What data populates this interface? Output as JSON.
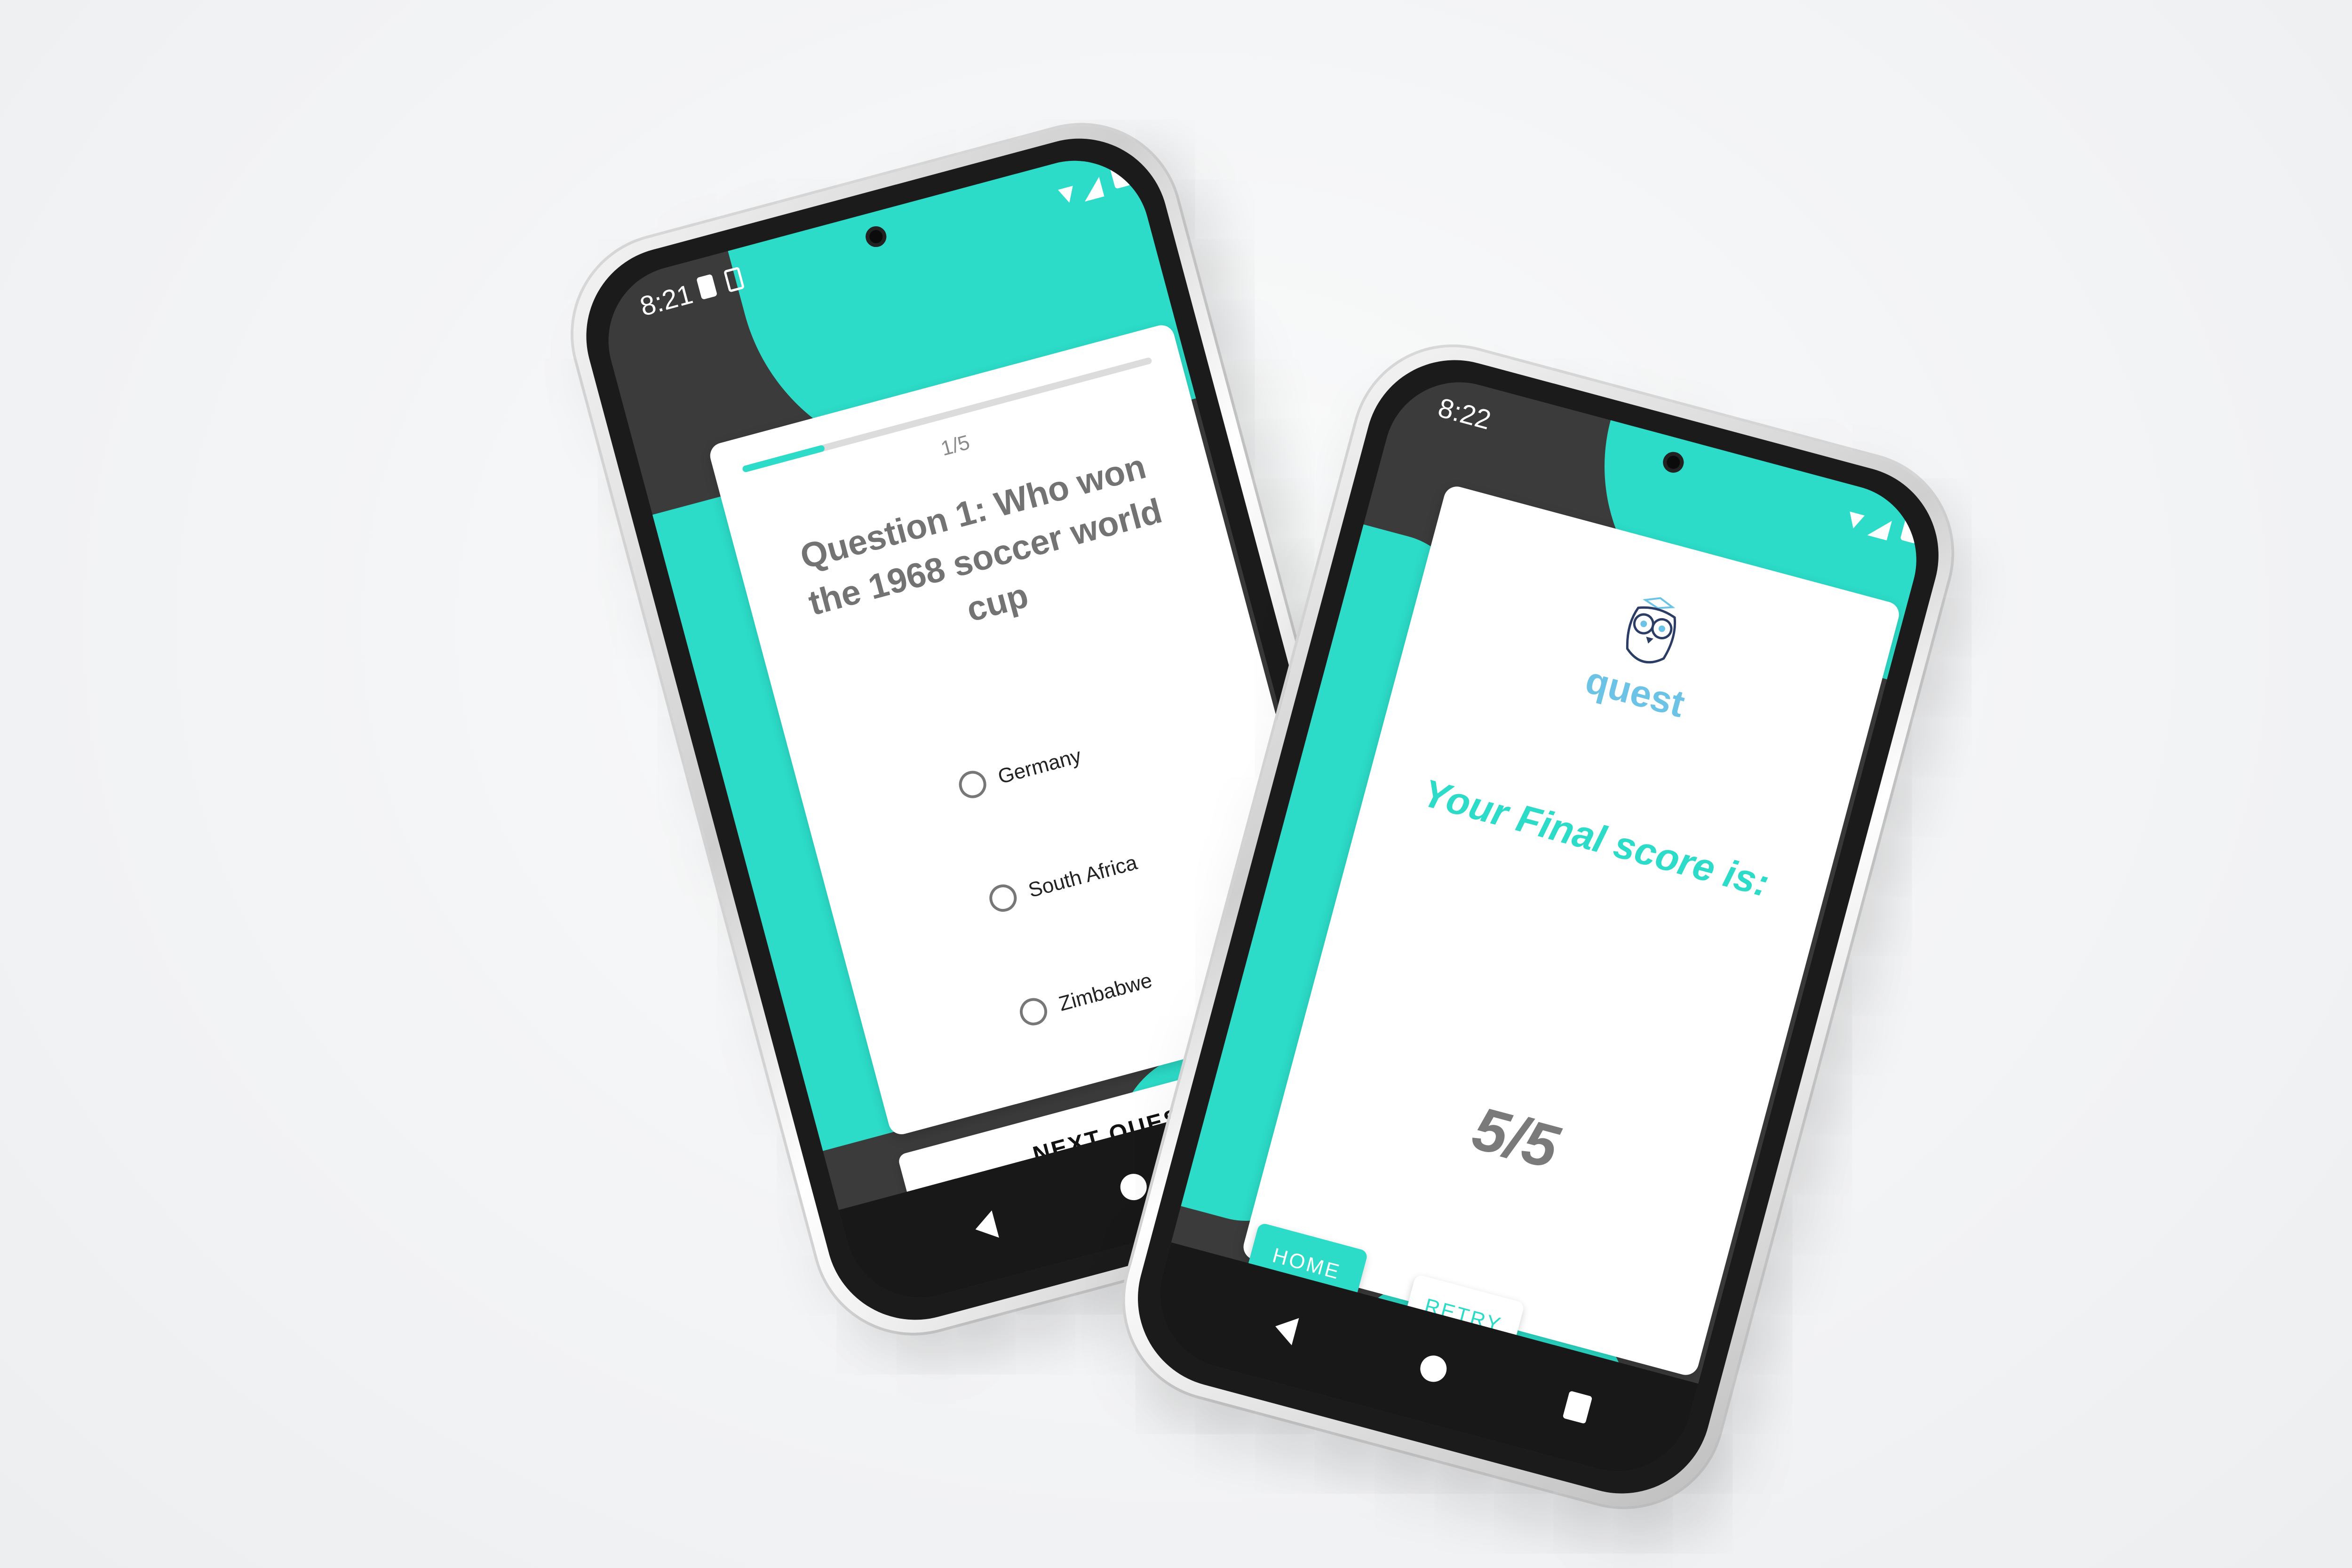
{
  "theme": {
    "accent": "#2cdcc8",
    "dark_background": "#3b3b3b",
    "logo_color": "#6cc3e6",
    "question_color": "#737373"
  },
  "quiz_screen": {
    "status": {
      "time": "8:21",
      "left_icons": [
        "sim-card-icon",
        "notification-icon"
      ],
      "right_icons": [
        "wifi-icon",
        "signal-icon",
        "battery-icon"
      ]
    },
    "progress": {
      "label": "1/5",
      "fraction": 0.2
    },
    "question": "Question 1: Who won the 1968 soccer world cup",
    "options": [
      "Germany",
      "South Africa",
      "Zimbabwe"
    ],
    "next_button": "NEXT QUESTION",
    "nav_icons": [
      "back-icon",
      "home-icon",
      "recent-apps-icon"
    ]
  },
  "result_screen": {
    "status": {
      "time": "8:22",
      "right_icons": [
        "wifi-icon",
        "signal-icon",
        "battery-icon"
      ]
    },
    "logo": {
      "icon": "owl-icon",
      "text": "quest"
    },
    "final_label": "Your Final score is:",
    "score": "5/5",
    "home_button": "HOME",
    "retry_button": "RETRY",
    "nav_icons": [
      "back-icon",
      "home-icon",
      "recent-apps-icon"
    ]
  }
}
